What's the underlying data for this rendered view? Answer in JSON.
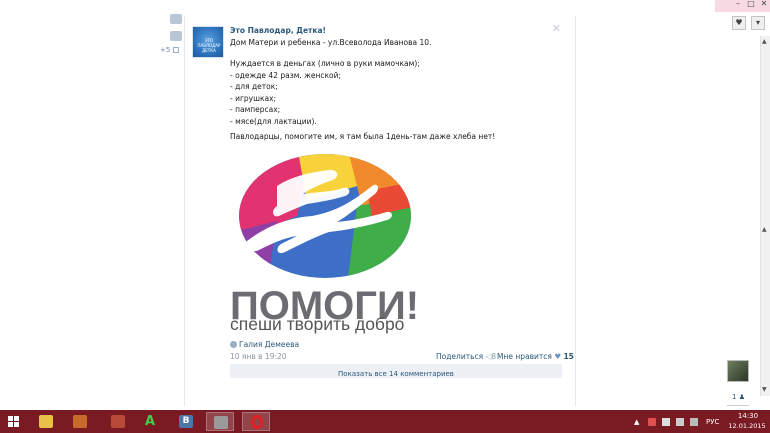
{
  "post": {
    "author": "Это Павлодар, Детка!",
    "subtitle": "Дом Матери и ребенка - ул.Всеволода Иванова 10.",
    "needs": [
      "Нуждается в деньгах (лично в руки мамочкам);",
      "- одежде 42 разм. женской;",
      "- для деток;",
      "- игрушках;",
      "- памперсах;",
      "- мясе(для лактации)."
    ],
    "appeal": "Павлодарцы, помогите им, я там была 1день-там даже хлеба нет!",
    "logo_word": "ПОМОГИ!",
    "logo_slogan": "спеши творить добро",
    "signer": "Галия Демеева",
    "date": "10 янв в 19:20",
    "share_label": "Поделиться",
    "share_count": "8",
    "like_label": "Мне нравится",
    "like_count": "15",
    "comments_label": "Показать все 14 комментариев"
  },
  "sidebar": {
    "plus_count": "+5"
  },
  "right_panel": {
    "count": "1"
  },
  "taskbar": {
    "lang": "РУС",
    "time": "14:30",
    "date": "12.01.2015"
  },
  "colors": {
    "link": "#2b587a",
    "taskbar": "#7a1b24",
    "logo_gray": "#6b6d70"
  }
}
